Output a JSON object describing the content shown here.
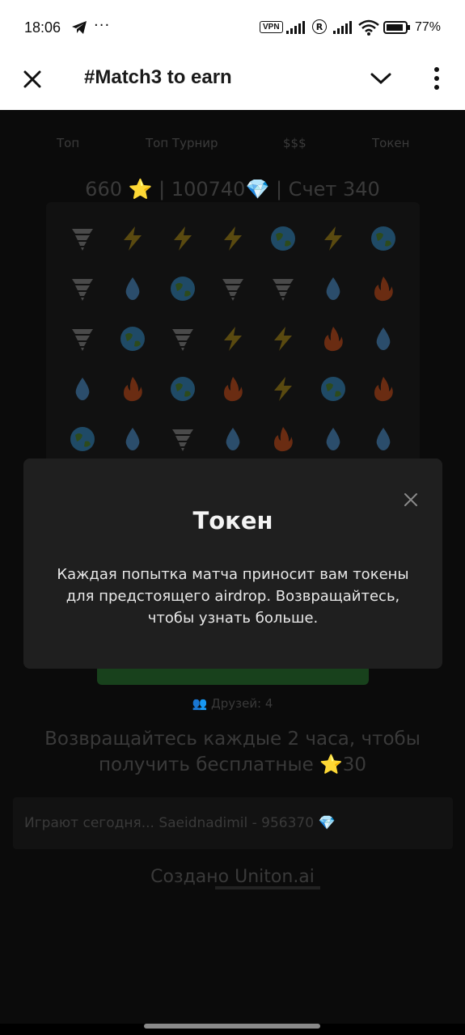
{
  "status": {
    "time": "18:06",
    "overflow": "···",
    "vpn": "VPN",
    "r": "R",
    "battery": "77%"
  },
  "app": {
    "title": "#Match3 to earn"
  },
  "tabs": [
    "Топ",
    "Топ Турнир",
    "$$$",
    "Токен"
  ],
  "score": "660 ⭐ | 100740💎 | Счет 340",
  "board": [
    [
      "tornado",
      "bolt",
      "bolt",
      "bolt",
      "globe",
      "bolt",
      "globe"
    ],
    [
      "tornado",
      "drop",
      "globe",
      "tornado",
      "tornado",
      "drop",
      "fire"
    ],
    [
      "tornado",
      "globe",
      "tornado",
      "bolt",
      "bolt",
      "fire",
      "drop"
    ],
    [
      "drop",
      "fire",
      "globe",
      "fire",
      "bolt",
      "globe",
      "fire"
    ],
    [
      "globe",
      "drop",
      "tornado",
      "drop",
      "fire",
      "drop",
      "drop"
    ]
  ],
  "friends": "👥 Друзей: 4",
  "comeback": "Возвращайтесь каждые 2 часа, чтобы получить бесплатные ⭐30",
  "ticker": "Играют сегодня... Saeidnadimil - 956370 💎",
  "created": "Создано Uniton.ai",
  "modal": {
    "title": "Токен",
    "body": "Каждая попытка матча приносит вам токены для предстоящего airdrop. Возвращайтесь, чтобы узнать больше."
  },
  "colors": {
    "bolt": "#5a4a10",
    "globe": "#1f4a66",
    "drop": "#2b4d6b",
    "fire": "#6a2c12",
    "tornado": "#4a4a4a"
  }
}
